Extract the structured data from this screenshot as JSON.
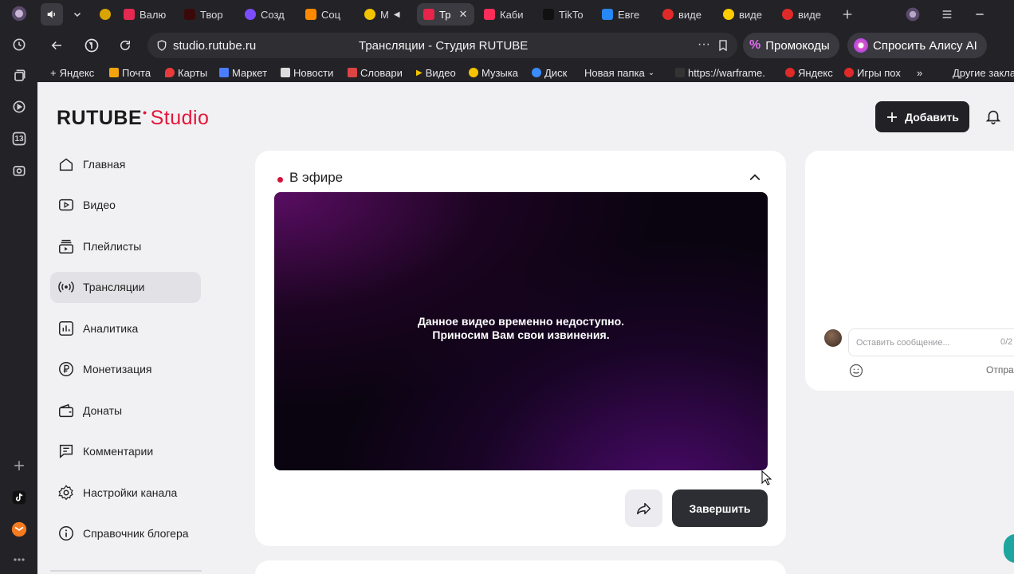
{
  "browser": {
    "tabs": [
      {
        "label": "Валю",
        "color": "#e62950"
      },
      {
        "label": "Твор",
        "color": "#3a0a0a"
      },
      {
        "label": "Созд",
        "color": "#7a4dff"
      },
      {
        "label": "Соц",
        "color": "#ff8a00"
      },
      {
        "label": "М",
        "color": "#f2c400"
      },
      {
        "label": "Тр",
        "color": "#e8244b"
      },
      {
        "label": "Каби",
        "color": "#ff2d5a"
      },
      {
        "label": "TikTo",
        "color": "#111111"
      },
      {
        "label": "Евге",
        "color": "#2787f5"
      },
      {
        "label": "виде",
        "color": "#e02a2a"
      },
      {
        "label": "виде",
        "color": "#ffcc00"
      },
      {
        "label": "виде",
        "color": "#e02a2a"
      }
    ],
    "url_host": "studio.rutube.ru",
    "page_title": "Трансляции - Студия RUTUBE",
    "promo_label": "Промокоды",
    "alice_label": "Спросить Алису AI",
    "bookmarks": [
      "Яндекс",
      "Почта",
      "Карты",
      "Маркет",
      "Новости",
      "Словари",
      "Видео",
      "Музыка",
      "Диск",
      "Новая папка",
      "https://warframe.",
      "Яндекс",
      "Игры пох",
      "Другие закла"
    ],
    "rail_badge": "13"
  },
  "app": {
    "logo_main": "RUTUBE",
    "logo_studio": "Studio",
    "add_button": "Добавить"
  },
  "sidebar": {
    "items": [
      {
        "label": "Главная"
      },
      {
        "label": "Видео"
      },
      {
        "label": "Плейлисты"
      },
      {
        "label": "Трансляции"
      },
      {
        "label": "Аналитика"
      },
      {
        "label": "Монетизация"
      },
      {
        "label": "Донаты"
      },
      {
        "label": "Комментарии"
      },
      {
        "label": "Настройки канала"
      },
      {
        "label": "Справочник блогера"
      }
    ]
  },
  "stream": {
    "section_title": "В эфире",
    "unavailable_line1": "Данное видео временно недоступно.",
    "unavailable_line2": "Приносим Вам свои извинения.",
    "end_button": "Завершить"
  },
  "chat": {
    "placeholder": "Оставить сообщение...",
    "counter": "0/2",
    "send_label": "Отпра"
  },
  "colors": {
    "accent": "#e3173b",
    "dark_button": "#2d2e33",
    "live_dot": "#d3123a"
  }
}
